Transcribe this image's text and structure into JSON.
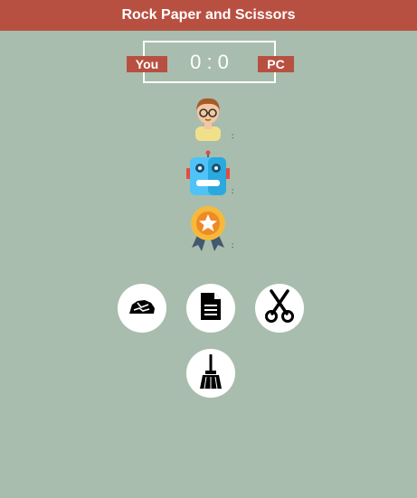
{
  "app": {
    "title": "Rock Paper and Scissors"
  },
  "score": {
    "you_label": "You",
    "pc_label": "PC",
    "text": "0 : 0"
  },
  "rows": {
    "user_choice": ":",
    "pc_choice": ":",
    "result": ":"
  },
  "buttons": [
    {
      "name": "rock",
      "icon": "rock-icon"
    },
    {
      "name": "paper",
      "icon": "document-icon"
    },
    {
      "name": "scissors",
      "icon": "scissors-icon"
    },
    {
      "name": "reset",
      "icon": "broom-icon"
    }
  ],
  "colors": {
    "header": "#b85042",
    "background": "#a8bdad",
    "white": "#ffffff"
  }
}
